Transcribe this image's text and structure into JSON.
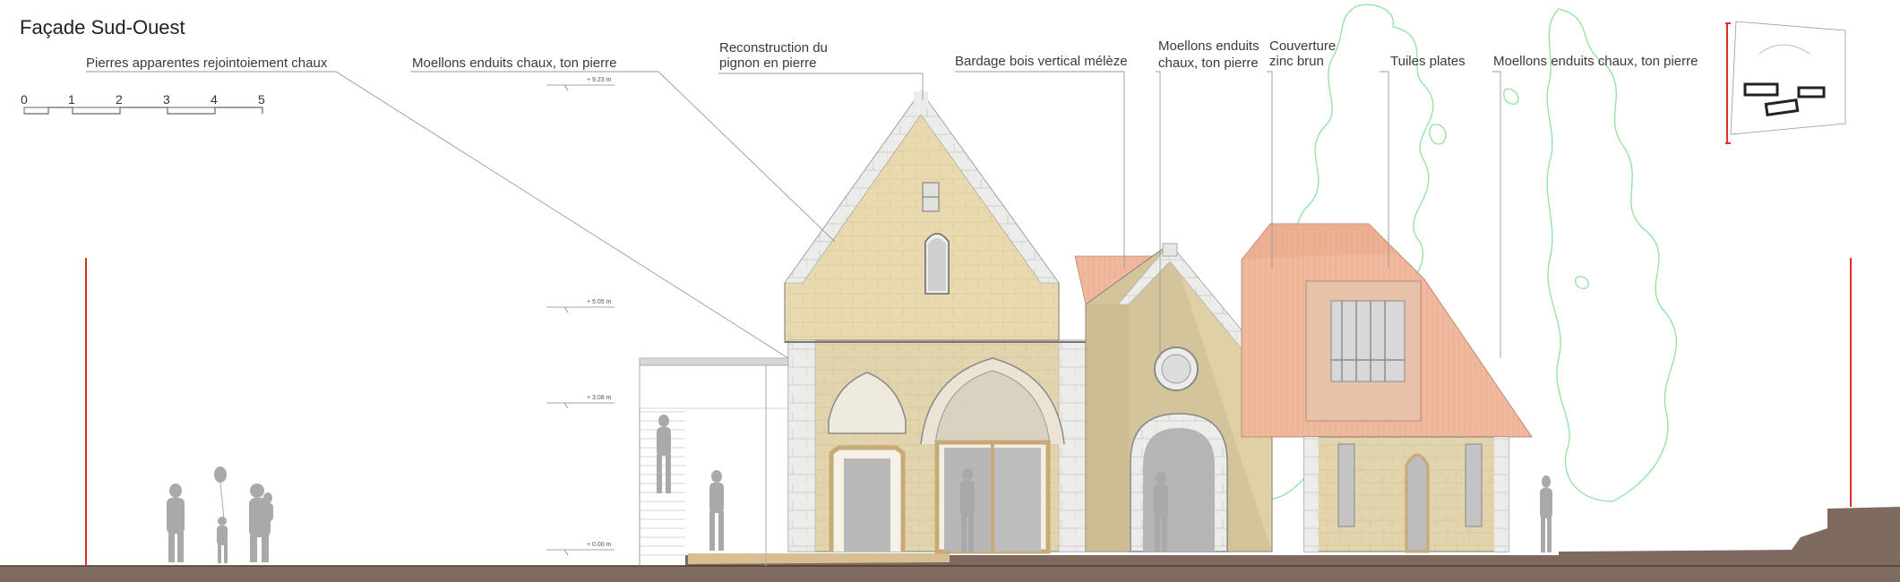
{
  "title": "Façade Sud-Ouest",
  "scale": {
    "ticks": [
      "0",
      "1",
      "2",
      "3",
      "4",
      "5"
    ]
  },
  "annotations": [
    "Pierres apparentes rejointoiement chaux",
    "Moellons enduits chaux, ton pierre",
    "Reconstruction du",
    "pignon en pierre",
    "Bardage bois vertical mélèze",
    "Moellons enduits",
    "chaux, ton pierre",
    "Couverture",
    "zinc brun",
    "Tuiles plates",
    "Moellons enduits chaux, ton pierre"
  ],
  "levels": [
    "+ 9.23 m",
    "+ 5.05 m",
    "+ 3.08 m",
    "+ 0.00 m"
  ],
  "colors": {
    "stone": "#e6d7ac",
    "stone_light": "#efe4c4",
    "quoin": "#e9e9e6",
    "roof_tile": "#f2bfa5",
    "ground": "#7f6a60",
    "red_marker": "#d9302c",
    "tree_outline": "#8fe3a0",
    "figure": "#a9a9a9"
  }
}
